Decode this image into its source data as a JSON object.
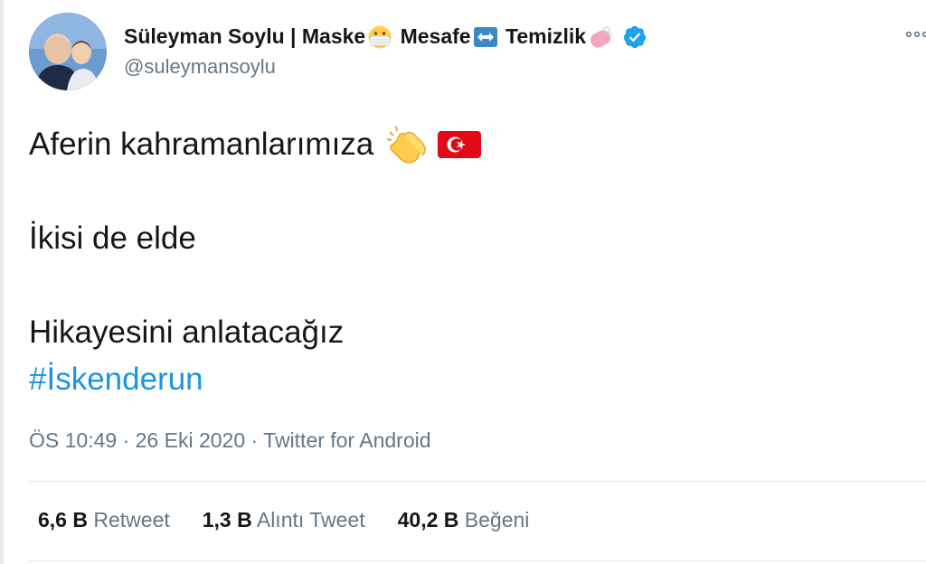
{
  "author": {
    "name_parts": [
      "Süleyman Soylu | Maske",
      "Mesafe",
      "Temizlik"
    ],
    "handle": "@suleymansoylu",
    "icons": [
      "mask-face-emoji",
      "left-right-arrow-emoji",
      "soap-emoji",
      "verified-badge"
    ]
  },
  "tweet": {
    "line1": "Aferin kahramanlarımıza",
    "line1_icons": [
      "clapping-hands-emoji",
      "turkey-flag-emoji"
    ],
    "line2": "İkisi de elde",
    "line3": "Hikayesini anlatacağız",
    "hashtag": "#İskenderun"
  },
  "meta": {
    "time": "ÖS 10:49",
    "date": "26 Eki 2020",
    "separator": "·",
    "source": "Twitter for Android"
  },
  "stats": [
    {
      "count": "6,6 B",
      "label": "Retweet"
    },
    {
      "count": "1,3 B",
      "label": "Alıntı Tweet"
    },
    {
      "count": "40,2 B",
      "label": "Beğeni"
    }
  ],
  "colors": {
    "link": "#1b95e0",
    "secondary_text": "#657786",
    "verified": "#1da1f2"
  }
}
